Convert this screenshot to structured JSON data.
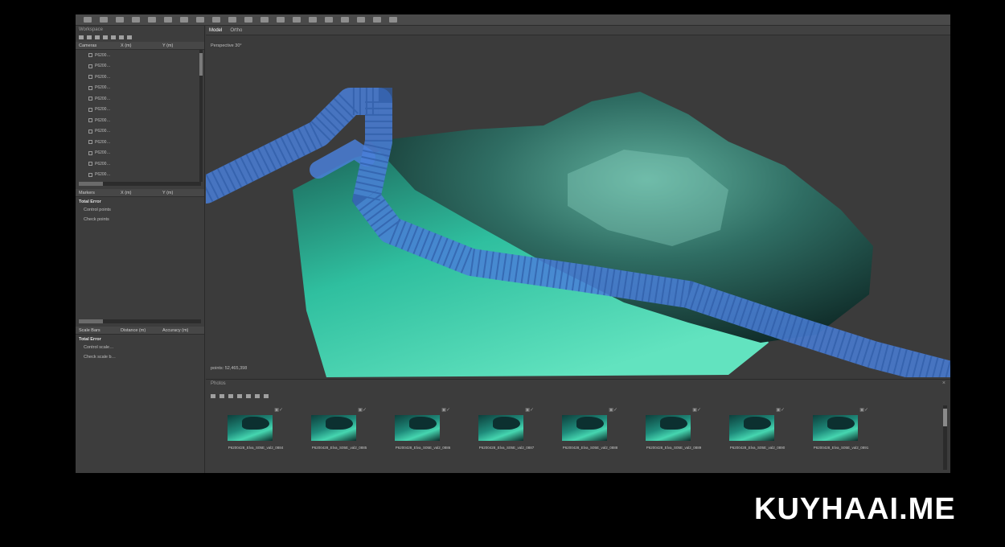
{
  "workspace": {
    "title": "Workspace",
    "cameras_header": [
      "Cameras",
      "X (m)",
      "Y (m)"
    ],
    "camera_label": "P6200…",
    "camera_count": 12,
    "markers_header": [
      "Markers",
      "X (m)",
      "Y (m)"
    ],
    "total_error_label": "Total Error",
    "control_points_label": "Control points",
    "check_points_label": "Check points",
    "scalebars_header": [
      "Scale Bars",
      "Distance (m)",
      "Accuracy (m)"
    ],
    "scalebars_total_error_label": "Total Error",
    "control_scale_label": "Control scale…",
    "check_scale_label": "Check scale b…"
  },
  "viewport": {
    "tabs": [
      "Model",
      "Ortho"
    ],
    "active_tab": "Model",
    "view_label": "Perspective 30°",
    "points_label": "points: 52,465,398"
  },
  "photos": {
    "title": "Photos",
    "close_icon": "close-icon",
    "items": [
      {
        "name": "P6200428_Elva_S05E_val2_0884"
      },
      {
        "name": "P6200428_Elva_S05E_val2_0885"
      },
      {
        "name": "P6200428_Elva_S05E_val2_0886"
      },
      {
        "name": "P6200428_Elva_S05E_val2_0887"
      },
      {
        "name": "P6200428_Elva_S05E_val2_0888"
      },
      {
        "name": "P6200428_Elva_S05E_val2_0889"
      },
      {
        "name": "P6200428_Elva_S05E_val2_0890"
      },
      {
        "name": "P6200428_Elva_S05E_val2_0891"
      }
    ]
  },
  "watermark": "KUYHAAI.ME",
  "colors": {
    "camera_strip": "#4a7fd8",
    "model_teal": "#2fbf9f"
  }
}
